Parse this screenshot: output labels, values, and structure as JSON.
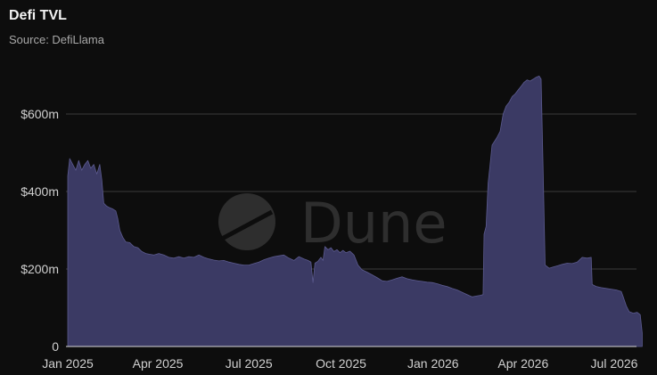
{
  "header": {
    "title": "Defi TVL",
    "subtitle": "Source: DefiLlama"
  },
  "watermark": {
    "text": "Dune",
    "icon": "dune-logo-icon"
  },
  "colors": {
    "background": "#0d0d0d",
    "area_fill": "#3b3a64",
    "area_stroke": "#5b5a8e",
    "grid": "#3a3a3a",
    "baseline": "#d8d8d8"
  },
  "chart_data": {
    "type": "area",
    "title": "Defi TVL",
    "subtitle": "Source: DefiLlama",
    "xlabel": "",
    "ylabel": "",
    "x_ticks": [
      "Jan 2025",
      "Apr 2025",
      "Jul 2025",
      "Oct 2025",
      "Jan 2026",
      "Apr 2026",
      "Jul 2026"
    ],
    "x_tick_dates": [
      "2025-01-01",
      "2025-04-01",
      "2025-07-01",
      "2025-10-01",
      "2026-01-01",
      "2026-04-01",
      "2026-07-01"
    ],
    "y_ticks": [
      {
        "value": 0,
        "label": "0"
      },
      {
        "value": 200,
        "label": "$200m"
      },
      {
        "value": 400,
        "label": "$400m"
      },
      {
        "value": 600,
        "label": "$600m"
      }
    ],
    "ylim": [
      0,
      700
    ],
    "xlim": [
      "2025-01-01",
      "2026-08-01"
    ],
    "grid": true,
    "legend": "none",
    "series": [
      {
        "points": [
          [
            "2025-01-01",
            440
          ],
          [
            "2025-01-03",
            485
          ],
          [
            "2025-01-06",
            470
          ],
          [
            "2025-01-09",
            455
          ],
          [
            "2025-01-12",
            480
          ],
          [
            "2025-01-15",
            455
          ],
          [
            "2025-01-18",
            470
          ],
          [
            "2025-01-21",
            480
          ],
          [
            "2025-01-24",
            460
          ],
          [
            "2025-01-27",
            470
          ],
          [
            "2025-01-30",
            445
          ],
          [
            "2025-02-02",
            470
          ],
          [
            "2025-02-04",
            430
          ],
          [
            "2025-02-06",
            370
          ],
          [
            "2025-02-09",
            362
          ],
          [
            "2025-02-12",
            358
          ],
          [
            "2025-02-15",
            355
          ],
          [
            "2025-02-18",
            350
          ],
          [
            "2025-02-20",
            330
          ],
          [
            "2025-02-22",
            300
          ],
          [
            "2025-02-25",
            282
          ],
          [
            "2025-02-28",
            270
          ],
          [
            "2025-03-04",
            268
          ],
          [
            "2025-03-08",
            258
          ],
          [
            "2025-03-12",
            255
          ],
          [
            "2025-03-16",
            245
          ],
          [
            "2025-03-20",
            240
          ],
          [
            "2025-03-24",
            238
          ],
          [
            "2025-03-28",
            236
          ],
          [
            "2025-04-02",
            240
          ],
          [
            "2025-04-07",
            236
          ],
          [
            "2025-04-12",
            230
          ],
          [
            "2025-04-17",
            228
          ],
          [
            "2025-04-22",
            232
          ],
          [
            "2025-04-27",
            228
          ],
          [
            "2025-05-02",
            232
          ],
          [
            "2025-05-07",
            230
          ],
          [
            "2025-05-12",
            236
          ],
          [
            "2025-05-17",
            230
          ],
          [
            "2025-05-22",
            226
          ],
          [
            "2025-05-27",
            223
          ],
          [
            "2025-06-01",
            221
          ],
          [
            "2025-06-06",
            222
          ],
          [
            "2025-06-11",
            218
          ],
          [
            "2025-06-16",
            215
          ],
          [
            "2025-06-21",
            212
          ],
          [
            "2025-06-26",
            210
          ],
          [
            "2025-07-01",
            210
          ],
          [
            "2025-07-06",
            214
          ],
          [
            "2025-07-11",
            218
          ],
          [
            "2025-07-16",
            224
          ],
          [
            "2025-07-21",
            228
          ],
          [
            "2025-07-26",
            232
          ],
          [
            "2025-07-31",
            234
          ],
          [
            "2025-08-05",
            236
          ],
          [
            "2025-08-10",
            228
          ],
          [
            "2025-08-15",
            222
          ],
          [
            "2025-08-20",
            232
          ],
          [
            "2025-08-25",
            226
          ],
          [
            "2025-08-29",
            222
          ],
          [
            "2025-09-01",
            218
          ],
          [
            "2025-09-03",
            165
          ],
          [
            "2025-09-05",
            215
          ],
          [
            "2025-09-08",
            220
          ],
          [
            "2025-09-11",
            230
          ],
          [
            "2025-09-13",
            222
          ],
          [
            "2025-09-15",
            258
          ],
          [
            "2025-09-18",
            250
          ],
          [
            "2025-09-21",
            255
          ],
          [
            "2025-09-24",
            245
          ],
          [
            "2025-09-27",
            250
          ],
          [
            "2025-09-30",
            242
          ],
          [
            "2025-10-03",
            248
          ],
          [
            "2025-10-06",
            242
          ],
          [
            "2025-10-10",
            246
          ],
          [
            "2025-10-14",
            236
          ],
          [
            "2025-10-18",
            210
          ],
          [
            "2025-10-22",
            198
          ],
          [
            "2025-10-27",
            192
          ],
          [
            "2025-11-01",
            185
          ],
          [
            "2025-11-06",
            178
          ],
          [
            "2025-11-11",
            170
          ],
          [
            "2025-11-16",
            168
          ],
          [
            "2025-11-21",
            172
          ],
          [
            "2025-11-26",
            176
          ],
          [
            "2025-12-01",
            180
          ],
          [
            "2025-12-06",
            175
          ],
          [
            "2025-12-11",
            172
          ],
          [
            "2025-12-16",
            170
          ],
          [
            "2025-12-21",
            168
          ],
          [
            "2025-12-26",
            166
          ],
          [
            "2025-12-31",
            165
          ],
          [
            "2026-01-05",
            162
          ],
          [
            "2026-01-10",
            158
          ],
          [
            "2026-01-15",
            155
          ],
          [
            "2026-01-20",
            150
          ],
          [
            "2026-01-25",
            146
          ],
          [
            "2026-01-30",
            140
          ],
          [
            "2026-02-04",
            134
          ],
          [
            "2026-02-09",
            128
          ],
          [
            "2026-02-13",
            130
          ],
          [
            "2026-02-17",
            132
          ],
          [
            "2026-02-20",
            134
          ],
          [
            "2026-02-21",
            290
          ],
          [
            "2026-02-23",
            310
          ],
          [
            "2026-02-25",
            420
          ],
          [
            "2026-02-27",
            470
          ],
          [
            "2026-03-01",
            520
          ],
          [
            "2026-03-03",
            528
          ],
          [
            "2026-03-06",
            540
          ],
          [
            "2026-03-09",
            555
          ],
          [
            "2026-03-12",
            600
          ],
          [
            "2026-03-15",
            620
          ],
          [
            "2026-03-18",
            630
          ],
          [
            "2026-03-21",
            645
          ],
          [
            "2026-03-24",
            652
          ],
          [
            "2026-03-27",
            662
          ],
          [
            "2026-03-30",
            672
          ],
          [
            "2026-04-02",
            682
          ],
          [
            "2026-04-05",
            688
          ],
          [
            "2026-04-08",
            685
          ],
          [
            "2026-04-11",
            690
          ],
          [
            "2026-04-14",
            695
          ],
          [
            "2026-04-17",
            698
          ],
          [
            "2026-04-19",
            690
          ],
          [
            "2026-04-21",
            450
          ],
          [
            "2026-04-23",
            210
          ],
          [
            "2026-04-27",
            202
          ],
          [
            "2026-05-01",
            205
          ],
          [
            "2026-05-05",
            208
          ],
          [
            "2026-05-10",
            212
          ],
          [
            "2026-05-15",
            215
          ],
          [
            "2026-05-20",
            214
          ],
          [
            "2026-05-25",
            218
          ],
          [
            "2026-05-30",
            230
          ],
          [
            "2026-06-04",
            228
          ],
          [
            "2026-06-08",
            230
          ],
          [
            "2026-06-09",
            160
          ],
          [
            "2026-06-13",
            155
          ],
          [
            "2026-06-18",
            152
          ],
          [
            "2026-06-23",
            150
          ],
          [
            "2026-06-28",
            148
          ],
          [
            "2026-07-03",
            146
          ],
          [
            "2026-07-08",
            142
          ],
          [
            "2026-07-10",
            128
          ],
          [
            "2026-07-13",
            105
          ],
          [
            "2026-07-16",
            90
          ],
          [
            "2026-07-20",
            86
          ],
          [
            "2026-07-24",
            88
          ],
          [
            "2026-07-27",
            82
          ],
          [
            "2026-07-29",
            35
          ]
        ]
      }
    ]
  }
}
